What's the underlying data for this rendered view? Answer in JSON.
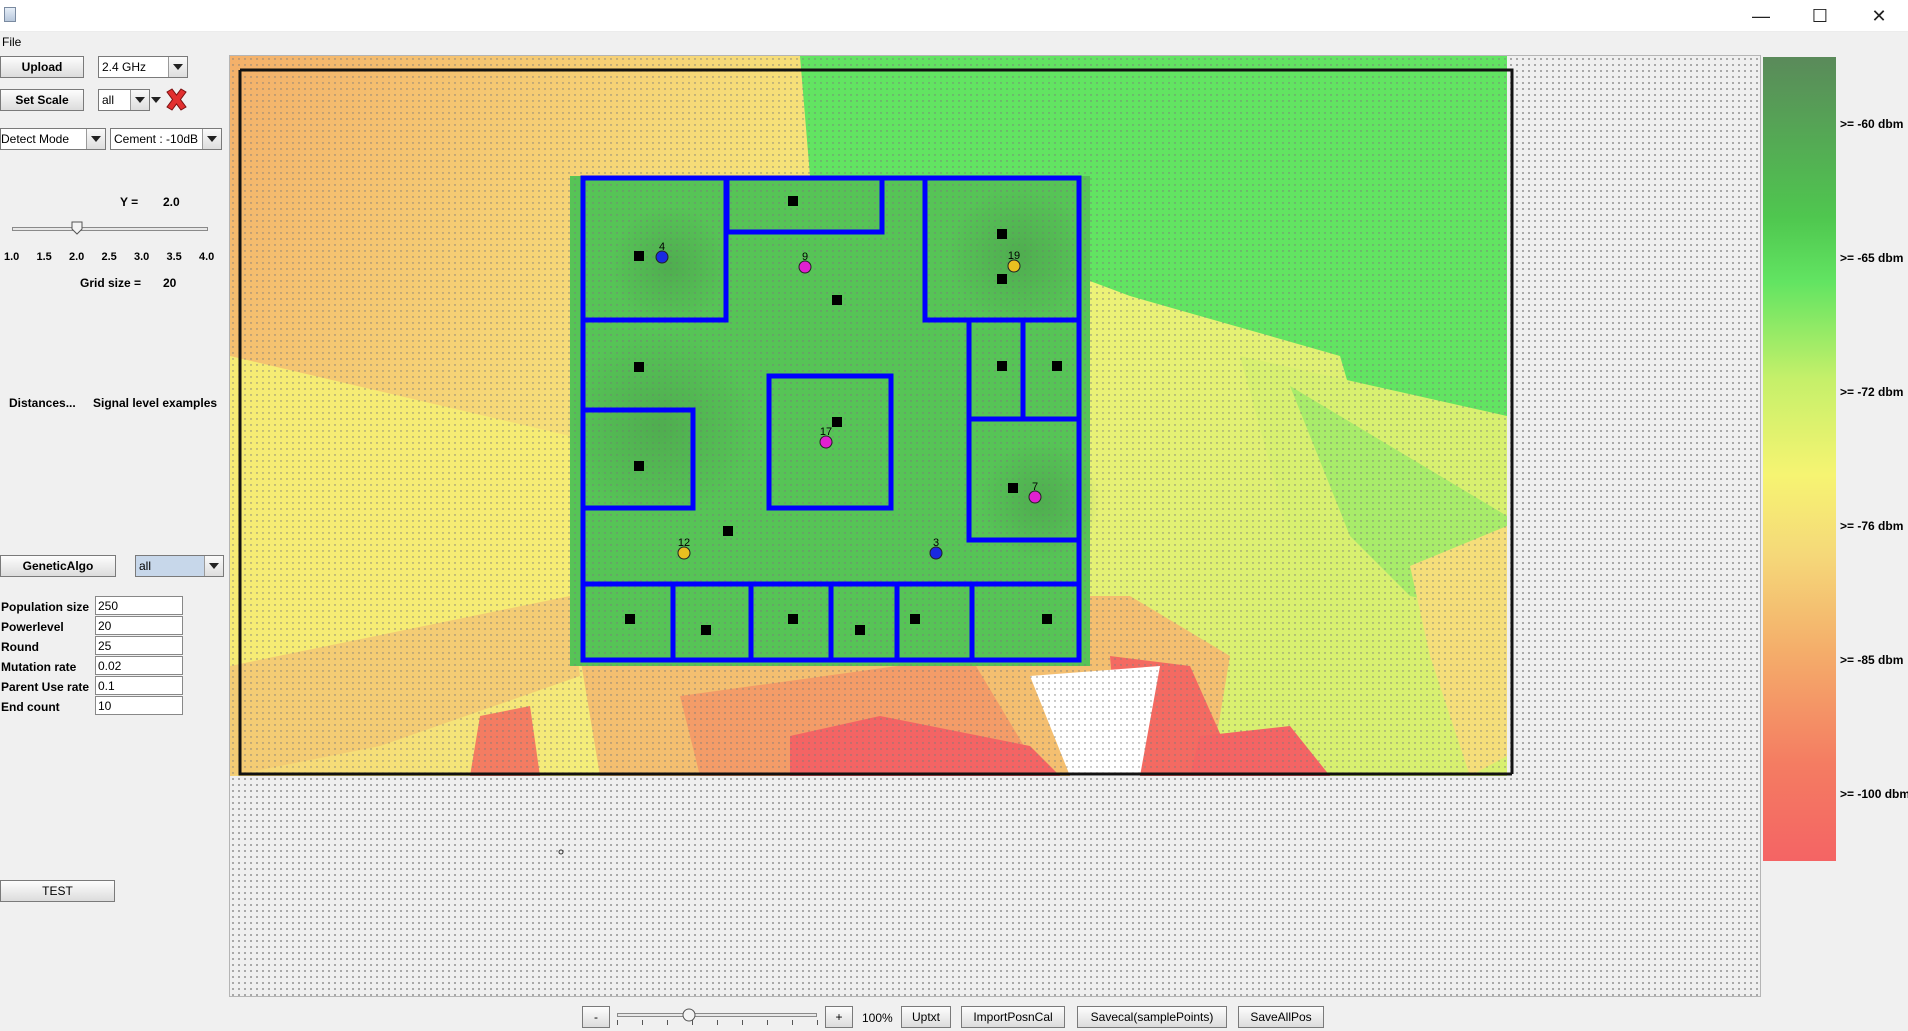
{
  "window": {
    "minimize": "—",
    "maximize": "☐",
    "close": "✕"
  },
  "menu": {
    "file": "File"
  },
  "left": {
    "upload": "Upload",
    "band_value": "2.4 GHz",
    "set_scale": "Set Scale",
    "scale_filter": "all",
    "detect_mode": "Detect Mode",
    "material": "Cement : -10dB",
    "y_label": "Y =",
    "y_value": "2.0",
    "y_slider_fraction": 0.333,
    "slider_ticks": [
      "1.0",
      "1.5",
      "2.0",
      "2.5",
      "3.0",
      "3.5",
      "4.0"
    ],
    "grid_label": "Grid size =",
    "grid_value": "20",
    "distances": "Distances...",
    "signal_examples": "Signal level examples",
    "genetic": "GeneticAlgo",
    "genetic_filter": "all",
    "params": [
      {
        "label": "Population size",
        "value": "250"
      },
      {
        "label": "Powerlevel",
        "value": "20"
      },
      {
        "label": "Round",
        "value": "25"
      },
      {
        "label": "Mutation rate",
        "value": "0.02"
      },
      {
        "label": "Parent Use rate",
        "value": "0.1"
      },
      {
        "label": "End count",
        "value": "10"
      }
    ],
    "test": "TEST"
  },
  "map": {
    "access_points": [
      {
        "label": "4",
        "color": "#1a2ae0"
      },
      {
        "label": "9",
        "color": "#e020d0"
      },
      {
        "label": "19",
        "color": "#e8c020"
      },
      {
        "label": "17",
        "color": "#e020d0"
      },
      {
        "label": "7",
        "color": "#e020d0"
      },
      {
        "label": "12",
        "color": "#e8c020"
      },
      {
        "label": "3",
        "color": "#1a2ae0"
      }
    ],
    "wall_color": "#0000ff"
  },
  "legend": [
    "&gt;= -60 dbm",
    "&gt;= -65 dbm",
    "&gt;= -72 dbm",
    "&gt;= -76 dbm",
    "&gt;= -85 dbm",
    "&gt;= -100 dbm"
  ],
  "bottom": {
    "zoom_out": "-",
    "zoom_in": "+",
    "zoom_level": "100%",
    "zoom_fraction": 0.36,
    "uptxt": "Uptxt",
    "import": "ImportPosnCal",
    "savecal": "Savecal(samplePoints)",
    "saveall": "SaveAllPos"
  }
}
